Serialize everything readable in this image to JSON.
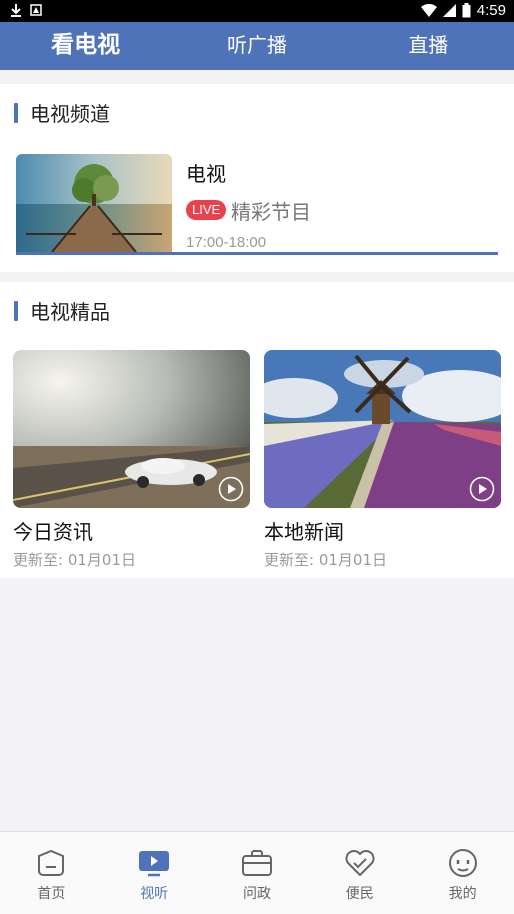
{
  "status_bar": {
    "time": "4:59"
  },
  "top_tabs": [
    {
      "label": "看电视",
      "active": true
    },
    {
      "label": "听广播",
      "active": false
    },
    {
      "label": "直播",
      "active": false
    }
  ],
  "tv_channels": {
    "title": "电视频道",
    "channel": {
      "name": "电视",
      "live_badge": "LIVE",
      "program": "精彩节目",
      "time": "17:00-18:00"
    }
  },
  "tv_featured": {
    "title": "电视精品",
    "items": [
      {
        "title": "今日资讯",
        "updated": "更新至: 01月01日"
      },
      {
        "title": "本地新闻",
        "updated": "更新至: 01月01日"
      }
    ]
  },
  "bottom_nav": [
    {
      "label": "首页",
      "icon": "home-icon",
      "active": false
    },
    {
      "label": "视听",
      "icon": "tv-play-icon",
      "active": true
    },
    {
      "label": "问政",
      "icon": "briefcase-icon",
      "active": false
    },
    {
      "label": "便民",
      "icon": "heart-icon",
      "active": false
    },
    {
      "label": "我的",
      "icon": "face-icon",
      "active": false
    }
  ],
  "colors": {
    "accent": "#4e73b9",
    "live": "#e8424f"
  }
}
